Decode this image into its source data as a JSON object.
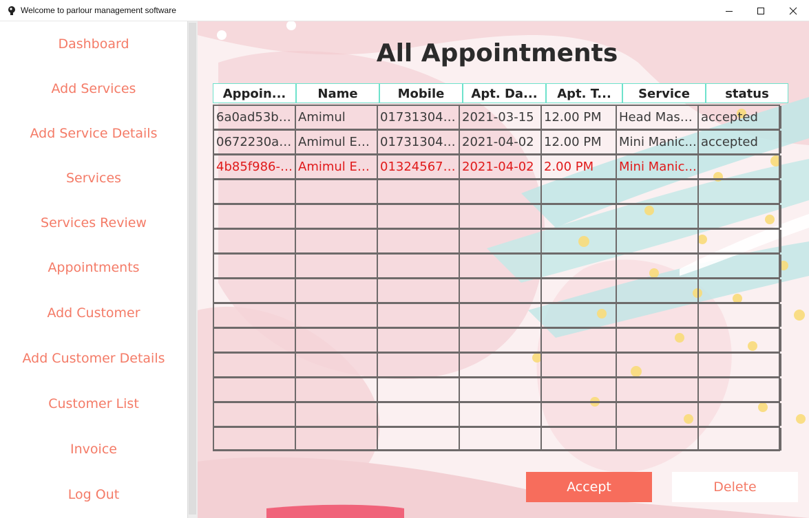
{
  "window": {
    "title": "Welcome to parlour management software",
    "controls": [
      "minimize-icon",
      "maximize-icon",
      "close-icon"
    ]
  },
  "sidebar": {
    "items": [
      {
        "label": "Dashboard"
      },
      {
        "label": "Add Services"
      },
      {
        "label": "Add Service Details"
      },
      {
        "label": "Services"
      },
      {
        "label": "Services Review"
      },
      {
        "label": "Appointments"
      },
      {
        "label": "Add Customer"
      },
      {
        "label": "Add Customer Details"
      },
      {
        "label": "Customer List"
      },
      {
        "label": "Invoice"
      },
      {
        "label": "Log Out"
      }
    ]
  },
  "main": {
    "title": "All Appointments",
    "table": {
      "headers": [
        "Appoin...",
        "Name",
        "Mobile",
        "Apt. Da...",
        "Apt. T...",
        "Service",
        "status"
      ],
      "rows": [
        [
          "6a0ad53b-...",
          "Amimul",
          "017313040...",
          "2021-03-15",
          "12.00 PM",
          "Head Mass...",
          "accepted"
        ],
        [
          "0672230a-...",
          "Amimul Eh...",
          "017313040...",
          "2021-04-02",
          "12.00 PM",
          "Mini Manic...",
          "accepted"
        ],
        [
          "4b85f986-f...",
          "Amimul Eh...",
          "013245678...",
          "2021-04-02",
          "2.00 PM",
          "Mini Manic...",
          ""
        ]
      ],
      "highlighted_row_color": "#e01a1a",
      "header_border_color": "#6ee2cc"
    },
    "buttons": {
      "accept_label": "Accept",
      "delete_label": "Delete"
    }
  },
  "colors": {
    "accent": "#f47b67",
    "accept_button": "#f76d5c"
  }
}
